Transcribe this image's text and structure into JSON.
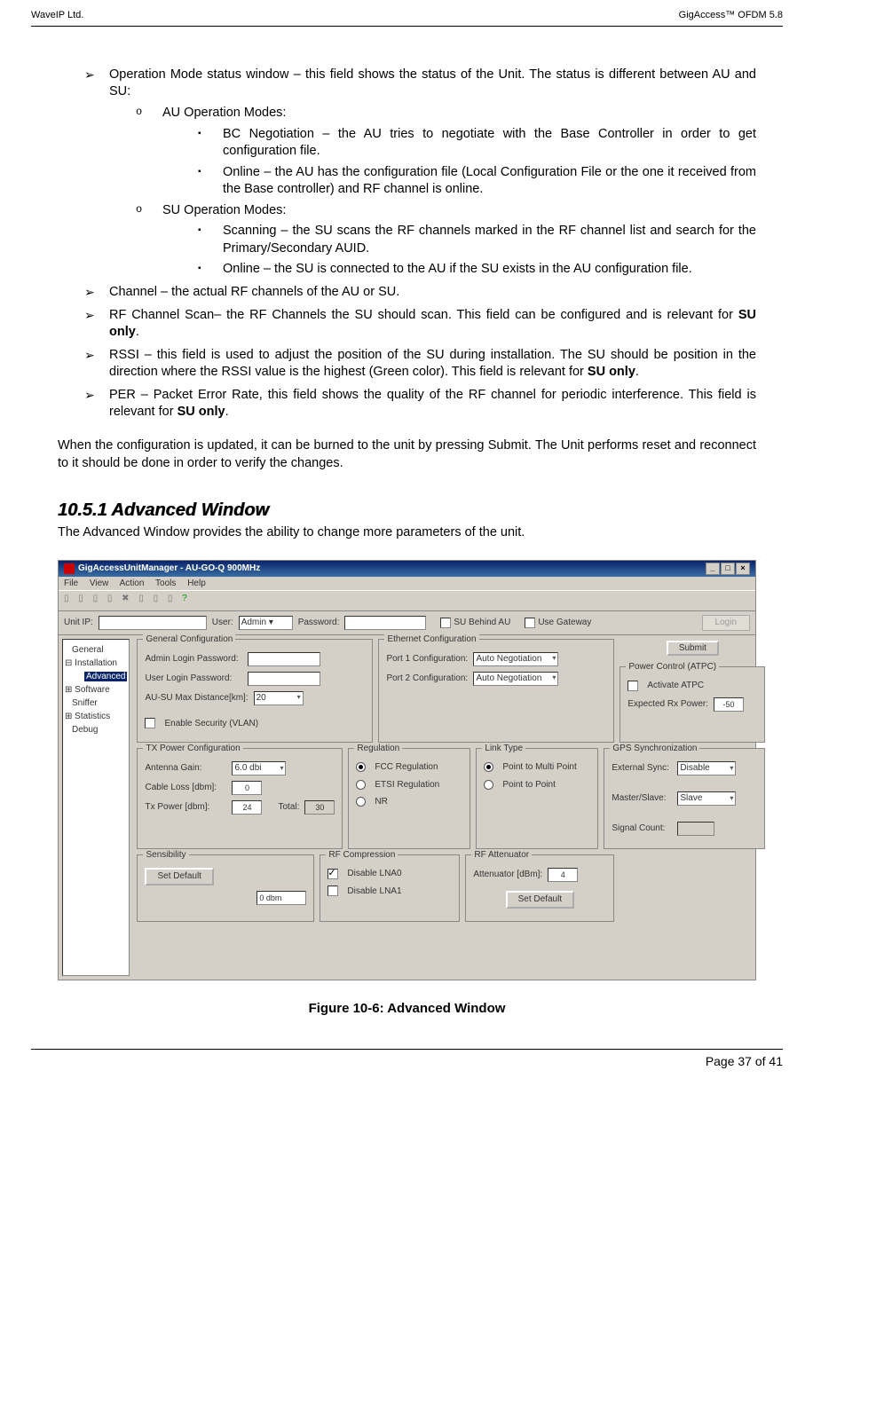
{
  "header": {
    "left": "WaveIP Ltd.",
    "right": "GigAccess™ OFDM 5.8"
  },
  "bullets": {
    "op_mode": "Operation Mode status window – this field shows the status of the Unit. The status is different between AU and SU:",
    "au_modes": "AU Operation Modes:",
    "au_bc": "BC Negotiation – the AU tries to negotiate with the Base Controller in order to get configuration file.",
    "au_online": "Online – the AU has the configuration file (Local Configuration File or the one it received from the Base controller) and RF channel is online.",
    "su_modes": "SU Operation Modes:",
    "su_scan": "Scanning – the SU scans the RF channels marked in the RF channel list and search for the Primary/Secondary AUID.",
    "su_online": "Online – the SU is connected to the AU if the SU exists in the AU configuration file.",
    "channel": "Channel – the actual RF channels of the AU or SU.",
    "rf_scan_a": "RF Channel Scan– the RF Channels the SU should scan. This field can be configured and is relevant for ",
    "rf_scan_b": "SU only",
    "rf_scan_c": ".",
    "rssi_a": "RSSI – this field is used to adjust the position of the SU during installation. The SU should be position in the direction where the RSSI value is the highest (Green color). This field is relevant for ",
    "rssi_b": "SU only",
    "rssi_c": ".",
    "per_a": "PER – Packet Error Rate, this field shows the quality of the RF channel for periodic interference. This field is relevant for ",
    "per_b": "SU only",
    "per_c": "."
  },
  "para1": "When the configuration is updated, it can be burned to the unit by pressing Submit. The Unit performs reset and reconnect to it should be done in order to verify the changes.",
  "section_title": "10.5.1 Advanced Window",
  "section_intro": "The Advanced Window provides the ability to change more parameters of the unit.",
  "figure_caption": "Figure 10-6: Advanced Window",
  "footer": "Page 37 of 41",
  "shot": {
    "title": "GigAccessUnitManager - AU-GO-Q  900MHz",
    "menu": {
      "file": "File",
      "view": "View",
      "action": "Action",
      "tools": "Tools",
      "help": "Help"
    },
    "ip": {
      "unit_ip": "Unit IP:",
      "user": "User:",
      "user_val": "Admin",
      "password": "Password:",
      "su_behind": "SU Behind AU",
      "use_gw": "Use Gateway",
      "login": "Login"
    },
    "tree": {
      "general": "General",
      "installation": "Installation",
      "advanced": "Advanced",
      "software": "Software",
      "sniffer": "Sniffer",
      "statistics": "Statistics",
      "debug": "Debug"
    },
    "groups": {
      "general": {
        "title": "General Configuration",
        "admin_pw": "Admin Login Password:",
        "user_pw": "User Login Password:",
        "max_dist": "AU-SU Max Distance[km]:",
        "max_dist_val": "20",
        "enable_sec": "Enable Security (VLAN)"
      },
      "eth": {
        "title": "Ethernet Configuration",
        "p1": "Port 1 Configuration:",
        "p2": "Port 2 Configuration:",
        "val": "Auto Negotiation"
      },
      "submit": "Submit",
      "atpc": {
        "title": "Power Control (ATPC)",
        "activate": "Activate ATPC",
        "expected": "Expected Rx Power:",
        "expected_val": "-50"
      },
      "txpower": {
        "title": "TX Power Configuration",
        "gain": "Antenna Gain:",
        "gain_val": "6.0 dbi",
        "cable": "Cable Loss [dbm]:",
        "cable_val": "0",
        "txp": "Tx Power [dbm]:",
        "txp_val": "24",
        "total": "Total:",
        "total_val": "30"
      },
      "reg": {
        "title": "Regulation",
        "fcc": "FCC Regulation",
        "etsi": "ETSI Regulation",
        "nr": "NR"
      },
      "link": {
        "title": "Link Type",
        "pmp": "Point to Multi Point",
        "ptp": "Point to Point"
      },
      "gps": {
        "title": "GPS Synchronization",
        "ext": "External Sync:",
        "ext_val": "Disable",
        "ms": "Master/Slave:",
        "ms_val": "Slave",
        "sig": "Signal Count:"
      },
      "sens": {
        "title": "Sensibility",
        "set_default": "Set Default",
        "val": "0 dbm"
      },
      "rfcomp": {
        "title": "RF Compression",
        "d0": "Disable LNA0",
        "d1": "Disable LNA1"
      },
      "rfatt": {
        "title": "RF Attenuator",
        "att": "Attenuator [dBm]:",
        "att_val": "4",
        "set_default": "Set Default"
      }
    }
  }
}
